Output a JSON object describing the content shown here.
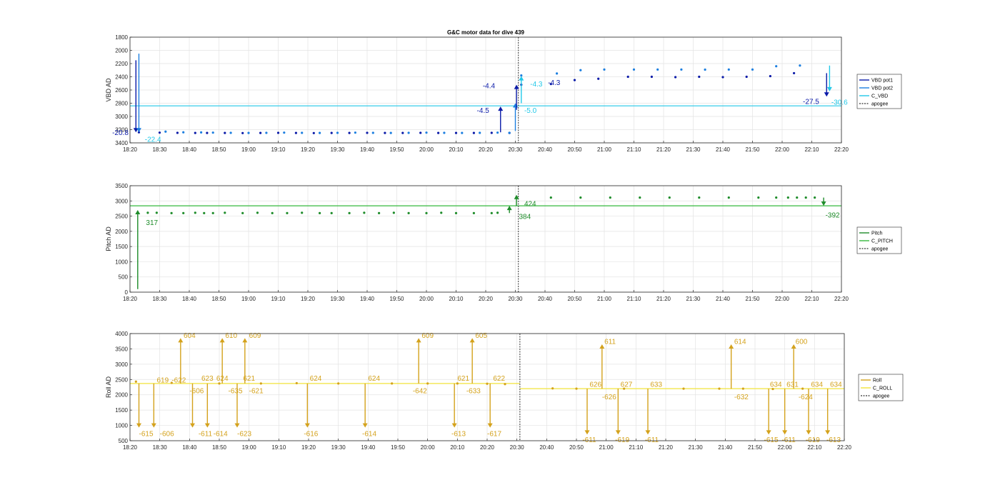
{
  "title": "G&C motor data for dive 439",
  "x_ticks": [
    "18:20",
    "18:30",
    "18:40",
    "18:50",
    "19:00",
    "19:10",
    "19:20",
    "19:30",
    "19:40",
    "19:50",
    "20:00",
    "20:10",
    "20:20",
    "20:30",
    "20:40",
    "20:50",
    "21:00",
    "21:10",
    "21:20",
    "21:30",
    "21:40",
    "21:50",
    "22:00",
    "22:10",
    "22:20"
  ],
  "colors": {
    "vbd_pot1": "#0a1aa8",
    "vbd_pot2": "#1c7fe0",
    "c_vbd": "#22c8e8",
    "pitch": "#1e8c2a",
    "c_pitch": "#35b83e",
    "roll": "#d4a21c",
    "c_roll": "#f2e33a",
    "apogee": "#555555"
  },
  "chart_data": [
    {
      "type": "scatter",
      "ylabel": "VBD AD",
      "ylim": [
        1800,
        3400
      ],
      "y_reversed": true,
      "y_ticks": [
        "1800",
        "2000",
        "2200",
        "2400",
        "2600",
        "2800",
        "3000",
        "3200",
        "3400"
      ],
      "xlim_minutes": [
        0,
        120
      ],
      "apogee_minute": 65.5,
      "legend": [
        "VBD pot1",
        "VBD pot2",
        "C_VBD",
        "apogee"
      ],
      "reference_line": {
        "name": "C_VBD",
        "value": 2840
      },
      "series": [
        {
          "name": "VBD pot1",
          "x_minutes": [
            1.5,
            5,
            8,
            11,
            13,
            16,
            19,
            22,
            25,
            28,
            31,
            34,
            37,
            40,
            43,
            46,
            49,
            52,
            55,
            58,
            61,
            64,
            66,
            71,
            75,
            79,
            84,
            88,
            92,
            96,
            100,
            104,
            108,
            112
          ],
          "values": [
            3240,
            3245,
            3248,
            3250,
            3250,
            3250,
            3252,
            3250,
            3248,
            3250,
            3252,
            3250,
            3250,
            3248,
            3250,
            3250,
            3248,
            3250,
            3250,
            3250,
            3248,
            3250,
            2520,
            2510,
            2450,
            2430,
            2400,
            2400,
            2405,
            2400,
            2405,
            2400,
            2390,
            2345
          ]
        },
        {
          "name": "VBD pot2",
          "x_minutes": [
            1.5,
            6,
            9,
            12,
            14,
            17,
            20,
            23,
            26,
            29,
            32,
            35,
            38,
            41,
            44,
            47,
            50,
            53,
            56,
            59,
            62,
            64,
            66,
            72,
            76,
            80,
            85,
            89,
            93,
            97,
            101,
            105,
            109,
            113
          ],
          "values": [
            3200,
            3230,
            3240,
            3242,
            3245,
            3248,
            3250,
            3248,
            3245,
            3248,
            3250,
            3248,
            3245,
            3248,
            3250,
            3248,
            3245,
            3248,
            3250,
            3248,
            3245,
            3248,
            2380,
            2350,
            2300,
            2290,
            2290,
            2290,
            2290,
            2292,
            2290,
            2290,
            2240,
            2230
          ]
        }
      ],
      "arrows": [
        {
          "x1": 1.0,
          "y1": 2150,
          "x2": 1.0,
          "y2": 3240,
          "series": "VBD pot1"
        },
        {
          "x1": 1.5,
          "y1": 2050,
          "x2": 1.5,
          "y2": 3240,
          "series": "VBD pot2"
        },
        {
          "x1": 62.5,
          "y1": 3240,
          "x2": 62.5,
          "y2": 2850,
          "series": "VBD pot1"
        },
        {
          "x1": 65.0,
          "y1": 3220,
          "x2": 65.0,
          "y2": 2800,
          "series": "VBD pot2"
        },
        {
          "x1": 65.2,
          "y1": 2900,
          "x2": 65.2,
          "y2": 2520,
          "series": "VBD pot1"
        },
        {
          "x1": 66.0,
          "y1": 2800,
          "x2": 66.0,
          "y2": 2390,
          "series": "C_VBD"
        },
        {
          "x1": 117.5,
          "y1": 2345,
          "x2": 117.5,
          "y2": 2700,
          "series": "VBD pot1"
        },
        {
          "x1": 118.0,
          "y1": 2230,
          "x2": 118.0,
          "y2": 2620,
          "series": "C_VBD"
        }
      ],
      "annotations": [
        {
          "text": "-20.8",
          "x": -3,
          "y": 3240,
          "series": "VBD pot1"
        },
        {
          "text": "-22.4",
          "x": 2.5,
          "y": 3340,
          "series": "C_VBD"
        },
        {
          "text": "-4.5",
          "x": 58.5,
          "y": 2900,
          "series": "VBD pot1"
        },
        {
          "text": "-4.4",
          "x": 59.5,
          "y": 2530,
          "series": "VBD pot1"
        },
        {
          "text": "-5.0",
          "x": 66.5,
          "y": 2900,
          "series": "C_VBD"
        },
        {
          "text": "-4.3",
          "x": 67.5,
          "y": 2500,
          "series": "C_VBD"
        },
        {
          "text": "-4.3",
          "x": 70.5,
          "y": 2480,
          "series": "VBD pot1"
        },
        {
          "text": "-27.5",
          "x": 113.5,
          "y": 2770,
          "series": "VBD pot1"
        },
        {
          "text": "-30.6",
          "x": 118.3,
          "y": 2780,
          "series": "C_VBD"
        }
      ]
    },
    {
      "type": "scatter",
      "ylabel": "Pitch AD",
      "ylim": [
        0,
        3500
      ],
      "y_ticks": [
        "0",
        "500",
        "1000",
        "1500",
        "2000",
        "2500",
        "3000",
        "3500"
      ],
      "xlim_minutes": [
        0,
        120
      ],
      "apogee_minute": 65.5,
      "legend": [
        "Pitch",
        "C_PITCH",
        "apogee"
      ],
      "reference_line": {
        "name": "C_PITCH",
        "value": 2840
      },
      "series": [
        {
          "name": "Pitch",
          "x_minutes": [
            3,
            4.5,
            7,
            9,
            11,
            12.5,
            14,
            16,
            19,
            21.5,
            24,
            26.5,
            29,
            32,
            34,
            37,
            39.5,
            42,
            44.5,
            47,
            50,
            52.5,
            55,
            58,
            61,
            62,
            71,
            76,
            81,
            86,
            91,
            96,
            101,
            106,
            109,
            111,
            112.5,
            114,
            115.5
          ],
          "values": [
            2610,
            2610,
            2600,
            2600,
            2610,
            2600,
            2600,
            2610,
            2600,
            2610,
            2600,
            2600,
            2610,
            2600,
            2600,
            2600,
            2610,
            2600,
            2610,
            2600,
            2600,
            2610,
            2600,
            2600,
            2600,
            2610,
            3110,
            3110,
            3110,
            3110,
            3110,
            3110,
            3110,
            3110,
            3110,
            3110,
            3110,
            3110,
            3110
          ]
        }
      ],
      "arrows": [
        {
          "x1": 1.3,
          "y1": 100,
          "x2": 1.3,
          "y2": 2700,
          "series": "Pitch"
        },
        {
          "x1": 64.0,
          "y1": 2600,
          "x2": 64.0,
          "y2": 2840,
          "series": "Pitch"
        },
        {
          "x1": 65.2,
          "y1": 2840,
          "x2": 65.2,
          "y2": 3200,
          "series": "Pitch"
        },
        {
          "x1": 117.0,
          "y1": 3110,
          "x2": 117.0,
          "y2": 2840,
          "series": "Pitch"
        }
      ],
      "annotations": [
        {
          "text": "317",
          "x": 2.7,
          "y": 2300,
          "series": "Pitch"
        },
        {
          "text": "384",
          "x": 65.6,
          "y": 2500,
          "series": "Pitch"
        },
        {
          "text": "424",
          "x": 66.5,
          "y": 2920,
          "series": "Pitch"
        },
        {
          "text": "-392",
          "x": 117.3,
          "y": 2550,
          "series": "Pitch"
        }
      ]
    },
    {
      "type": "scatter",
      "ylabel": "Roll AD",
      "ylim": [
        500,
        4000
      ],
      "y_ticks": [
        "500",
        "1000",
        "1500",
        "2000",
        "2500",
        "3000",
        "3500",
        "4000"
      ],
      "xlim_minutes": [
        0,
        120
      ],
      "apogee_minute": 65.5,
      "legend": [
        "Roll",
        "C_ROLL",
        "apogee"
      ],
      "reference_line": {
        "name": "C_ROLL",
        "value_before_apogee": 2370,
        "value_after_apogee": 2200
      },
      "series": [
        {
          "name": "Roll",
          "x_minutes": [
            1,
            7,
            15,
            22,
            28,
            35,
            44,
            50,
            55,
            60,
            63,
            71,
            75,
            83,
            93,
            99,
            103,
            108,
            113
          ],
          "values": [
            2430,
            2390,
            2370,
            2370,
            2380,
            2370,
            2370,
            2370,
            2370,
            2360,
            2350,
            2210,
            2200,
            2200,
            2200,
            2200,
            2200,
            2190,
            2200
          ]
        }
      ],
      "arrows": [
        {
          "x1": 1.5,
          "y1": 2370,
          "x2": 1.5,
          "y2": 930,
          "series": "Roll"
        },
        {
          "x1": 4.0,
          "y1": 2370,
          "x2": 4.0,
          "y2": 930,
          "series": "Roll"
        },
        {
          "x1": 8.5,
          "y1": 2370,
          "x2": 8.5,
          "y2": 3850,
          "series": "Roll"
        },
        {
          "x1": 10.5,
          "y1": 2370,
          "x2": 10.5,
          "y2": 930,
          "series": "Roll"
        },
        {
          "x1": 13.0,
          "y1": 2370,
          "x2": 13.0,
          "y2": 930,
          "series": "Roll"
        },
        {
          "x1": 15.5,
          "y1": 2370,
          "x2": 15.5,
          "y2": 3850,
          "series": "Roll"
        },
        {
          "x1": 18.0,
          "y1": 2370,
          "x2": 18.0,
          "y2": 930,
          "series": "Roll"
        },
        {
          "x1": 19.3,
          "y1": 2370,
          "x2": 19.3,
          "y2": 3850,
          "series": "Roll"
        },
        {
          "x1": 29.8,
          "y1": 2370,
          "x2": 29.8,
          "y2": 930,
          "series": "Roll"
        },
        {
          "x1": 39.5,
          "y1": 2370,
          "x2": 39.5,
          "y2": 930,
          "series": "Roll"
        },
        {
          "x1": 48.5,
          "y1": 2370,
          "x2": 48.5,
          "y2": 3850,
          "series": "Roll"
        },
        {
          "x1": 54.5,
          "y1": 2370,
          "x2": 54.5,
          "y2": 930,
          "series": "Roll"
        },
        {
          "x1": 57.5,
          "y1": 2370,
          "x2": 57.5,
          "y2": 3850,
          "series": "Roll"
        },
        {
          "x1": 60.5,
          "y1": 2370,
          "x2": 60.5,
          "y2": 930,
          "series": "Roll"
        },
        {
          "x1": 76.8,
          "y1": 2200,
          "x2": 76.8,
          "y2": 700,
          "series": "Roll"
        },
        {
          "x1": 79.3,
          "y1": 2200,
          "x2": 79.3,
          "y2": 3650,
          "series": "Roll"
        },
        {
          "x1": 82.0,
          "y1": 2200,
          "x2": 82.0,
          "y2": 700,
          "series": "Roll"
        },
        {
          "x1": 87.0,
          "y1": 2200,
          "x2": 87.0,
          "y2": 700,
          "series": "Roll"
        },
        {
          "x1": 101.0,
          "y1": 2200,
          "x2": 101.0,
          "y2": 3650,
          "series": "Roll"
        },
        {
          "x1": 107.3,
          "y1": 2200,
          "x2": 107.3,
          "y2": 700,
          "series": "Roll"
        },
        {
          "x1": 110.0,
          "y1": 2200,
          "x2": 110.0,
          "y2": 700,
          "series": "Roll"
        },
        {
          "x1": 111.5,
          "y1": 2200,
          "x2": 111.5,
          "y2": 3650,
          "series": "Roll"
        },
        {
          "x1": 114.0,
          "y1": 2200,
          "x2": 114.0,
          "y2": 700,
          "series": "Roll"
        },
        {
          "x1": 117.2,
          "y1": 2200,
          "x2": 117.2,
          "y2": 700,
          "series": "Roll"
        }
      ],
      "annotations": [
        {
          "text": "-615",
          "x": 1.5,
          "y": 750,
          "series": "Roll"
        },
        {
          "text": "619",
          "x": 4.5,
          "y": 2500,
          "series": "Roll"
        },
        {
          "text": "-606",
          "x": 5.0,
          "y": 750,
          "series": "Roll"
        },
        {
          "text": "-622",
          "x": 7.0,
          "y": 2500,
          "series": "Roll"
        },
        {
          "text": "604",
          "x": 9.0,
          "y": 3950,
          "series": "Roll"
        },
        {
          "text": "-606",
          "x": 10.0,
          "y": 2150,
          "series": "Roll"
        },
        {
          "text": "623",
          "x": 12.0,
          "y": 2550,
          "series": "Roll"
        },
        {
          "text": "-611",
          "x": 11.5,
          "y": 750,
          "series": "Roll"
        },
        {
          "text": "624",
          "x": 14.5,
          "y": 2550,
          "series": "Roll"
        },
        {
          "text": "-614",
          "x": 14.0,
          "y": 750,
          "series": "Roll"
        },
        {
          "text": "610",
          "x": 16.0,
          "y": 3950,
          "series": "Roll"
        },
        {
          "text": "-635",
          "x": 16.5,
          "y": 2150,
          "series": "Roll"
        },
        {
          "text": "621",
          "x": 19.0,
          "y": 2550,
          "series": "Roll"
        },
        {
          "text": "609",
          "x": 20.0,
          "y": 3950,
          "series": "Roll"
        },
        {
          "text": "-623",
          "x": 18.0,
          "y": 750,
          "series": "Roll"
        },
        {
          "text": "-621",
          "x": 20.0,
          "y": 2150,
          "series": "Roll"
        },
        {
          "text": "624",
          "x": 30.2,
          "y": 2550,
          "series": "Roll"
        },
        {
          "text": "-616",
          "x": 29.2,
          "y": 750,
          "series": "Roll"
        },
        {
          "text": "624",
          "x": 40.0,
          "y": 2550,
          "series": "Roll"
        },
        {
          "text": "-614",
          "x": 39.0,
          "y": 750,
          "series": "Roll"
        },
        {
          "text": "609",
          "x": 49.0,
          "y": 3950,
          "series": "Roll"
        },
        {
          "text": "-642",
          "x": 47.5,
          "y": 2150,
          "series": "Roll"
        },
        {
          "text": "621",
          "x": 55.0,
          "y": 2550,
          "series": "Roll"
        },
        {
          "text": "-613",
          "x": 54.0,
          "y": 750,
          "series": "Roll"
        },
        {
          "text": "605",
          "x": 58.0,
          "y": 3950,
          "series": "Roll"
        },
        {
          "text": "-633",
          "x": 56.5,
          "y": 2150,
          "series": "Roll"
        },
        {
          "text": "622",
          "x": 61.0,
          "y": 2550,
          "series": "Roll"
        },
        {
          "text": "-617",
          "x": 60.0,
          "y": 750,
          "series": "Roll"
        },
        {
          "text": "626",
          "x": 77.2,
          "y": 2350,
          "series": "Roll"
        },
        {
          "text": "-611",
          "x": 76.0,
          "y": 550,
          "series": "Roll"
        },
        {
          "text": "611",
          "x": 79.7,
          "y": 3750,
          "series": "Roll"
        },
        {
          "text": "-626",
          "x": 79.3,
          "y": 1950,
          "series": "Roll"
        },
        {
          "text": "627",
          "x": 82.4,
          "y": 2350,
          "series": "Roll"
        },
        {
          "text": "-619",
          "x": 81.5,
          "y": 550,
          "series": "Roll"
        },
        {
          "text": "633",
          "x": 87.4,
          "y": 2350,
          "series": "Roll"
        },
        {
          "text": "-611",
          "x": 86.5,
          "y": 550,
          "series": "Roll"
        },
        {
          "text": "614",
          "x": 101.5,
          "y": 3750,
          "series": "Roll"
        },
        {
          "text": "-632",
          "x": 101.5,
          "y": 1950,
          "series": "Roll"
        },
        {
          "text": "634",
          "x": 107.5,
          "y": 2350,
          "series": "Roll"
        },
        {
          "text": "-615",
          "x": 106.5,
          "y": 550,
          "series": "Roll"
        },
        {
          "text": "631",
          "x": 110.3,
          "y": 2350,
          "series": "Roll"
        },
        {
          "text": "-611",
          "x": 109.5,
          "y": 550,
          "series": "Roll"
        },
        {
          "text": "600",
          "x": 111.8,
          "y": 3750,
          "series": "Roll"
        },
        {
          "text": "-624",
          "x": 112.3,
          "y": 1950,
          "series": "Roll"
        },
        {
          "text": "634",
          "x": 114.4,
          "y": 2350,
          "series": "Roll"
        },
        {
          "text": "-619",
          "x": 113.5,
          "y": 550,
          "series": "Roll"
        },
        {
          "text": "634",
          "x": 117.6,
          "y": 2350,
          "series": "Roll"
        },
        {
          "text": "-613",
          "x": 117.0,
          "y": 550,
          "series": "Roll"
        }
      ]
    }
  ]
}
